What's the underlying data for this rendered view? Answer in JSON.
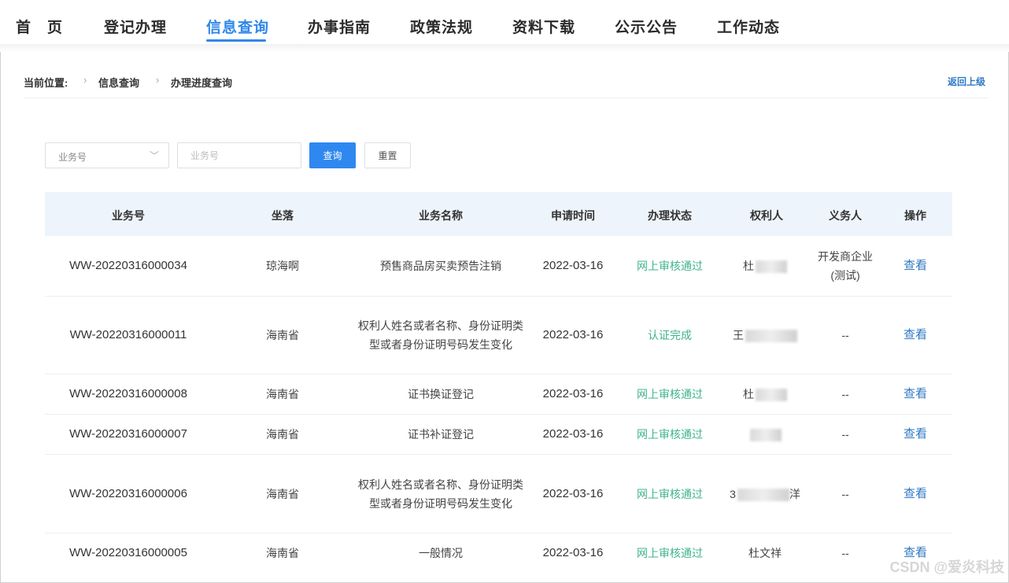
{
  "nav": {
    "items": [
      "首　页",
      "登记办理",
      "信息查询",
      "办事指南",
      "政策法规",
      "资料下载",
      "公示公告",
      "工作动态"
    ],
    "active_index": 2
  },
  "breadcrumb": {
    "prefix": "当前位置:",
    "level1": "信息查询",
    "level2": "办理进度查询",
    "back": "返回上级"
  },
  "search": {
    "select_value": "业务号",
    "input_placeholder": "业务号",
    "query_label": "查询",
    "reset_label": "重置"
  },
  "table": {
    "headers": [
      "业务号",
      "坐落",
      "业务名称",
      "申请时间",
      "办理状态",
      "权利人",
      "义务人",
      "操作"
    ],
    "rows": [
      {
        "id": "WW-20220316000034",
        "location": "琼海啊",
        "name": "预售商品房买卖预告注销",
        "date": "2022-03-16",
        "status": "网上审核通过",
        "holder": "杜",
        "obligor": "开发商企业(测试)",
        "action": "查看"
      },
      {
        "id": "WW-20220316000011",
        "location": "海南省",
        "name": "权利人姓名或者名称、身份证明类型或者身份证明号码发生变化",
        "date": "2022-03-16",
        "status": "认证完成",
        "holder": "王",
        "obligor": "--",
        "action": "查看"
      },
      {
        "id": "WW-20220316000008",
        "location": "海南省",
        "name": "证书换证登记",
        "date": "2022-03-16",
        "status": "网上审核通过",
        "holder": "杜",
        "obligor": "--",
        "action": "查看"
      },
      {
        "id": "WW-20220316000007",
        "location": "海南省",
        "name": "证书补证登记",
        "date": "2022-03-16",
        "status": "网上审核通过",
        "holder": "",
        "obligor": "--",
        "action": "查看"
      },
      {
        "id": "WW-20220316000006",
        "location": "海南省",
        "name": "权利人姓名或者名称、身份证明类型或者身份证明号码发生变化",
        "date": "2022-03-16",
        "status": "网上审核通过",
        "holder": "3",
        "holder_suffix": "洋",
        "obligor": "--",
        "action": "查看"
      },
      {
        "id": "WW-20220316000005",
        "location": "海南省",
        "name": "一般情况",
        "date": "2022-03-16",
        "status": "网上审核通过",
        "holder": "杜文祥",
        "obligor": "--",
        "action": "查看"
      }
    ]
  },
  "watermark": "CSDN @爱炎科技"
}
